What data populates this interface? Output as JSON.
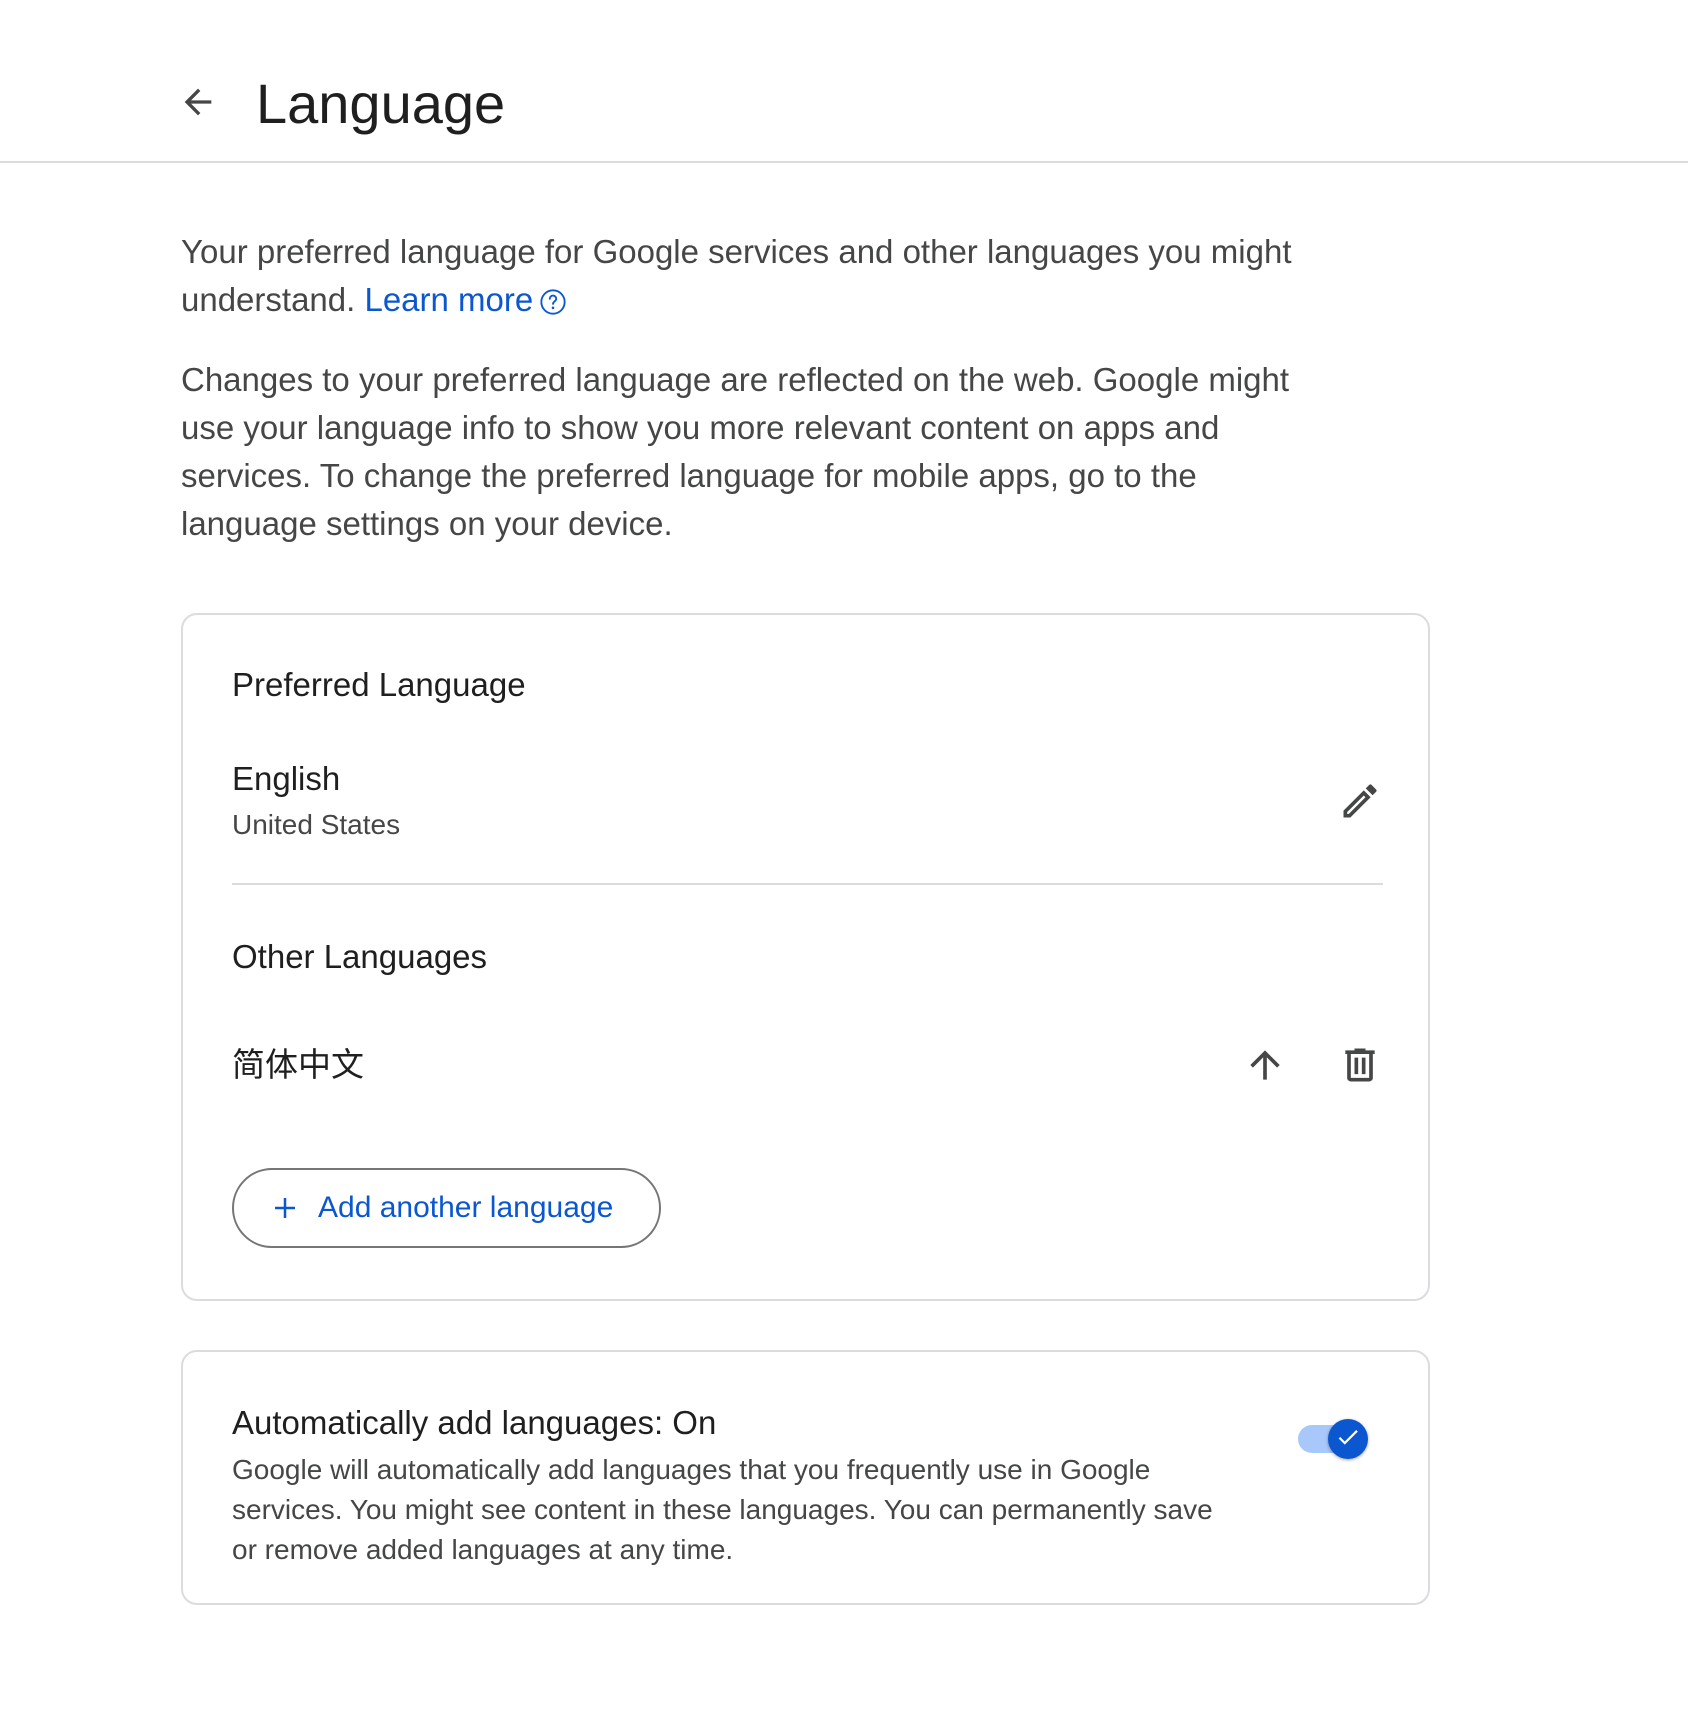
{
  "header": {
    "title": "Language",
    "back_icon": "arrow-left-icon"
  },
  "intro": {
    "text": "Your preferred language for Google services and other languages you might understand. ",
    "learn_more": "Learn more",
    "help_icon": "help-circle-icon"
  },
  "changes": {
    "text": "Changes to your preferred language are reflected on the web. Google might use your language info to show you more relevant content on apps and services. To change the preferred language for mobile apps, go to the language settings on your device."
  },
  "preferred": {
    "title": "Preferred Language",
    "language": "English",
    "region": "United States",
    "edit_icon": "pencil-icon"
  },
  "other": {
    "title": "Other Languages",
    "languages": [
      {
        "name": "简体中文",
        "move_up_icon": "arrow-up-icon",
        "delete_icon": "trash-icon"
      }
    ],
    "add_button": "Add another language",
    "add_icon": "plus-icon"
  },
  "auto_add": {
    "title": "Automatically add languages: On",
    "description": "Google will automatically add languages that you frequently use in Google services. You might see content in these languages. You can permanently save or remove added languages at any time.",
    "enabled": true,
    "check_icon": "check-icon"
  },
  "colors": {
    "accent": "#0b57d0",
    "toggle_track": "#a8c7fa",
    "divider": "#dadce0",
    "text_primary": "#1f1f1f",
    "text_secondary": "#444746"
  }
}
